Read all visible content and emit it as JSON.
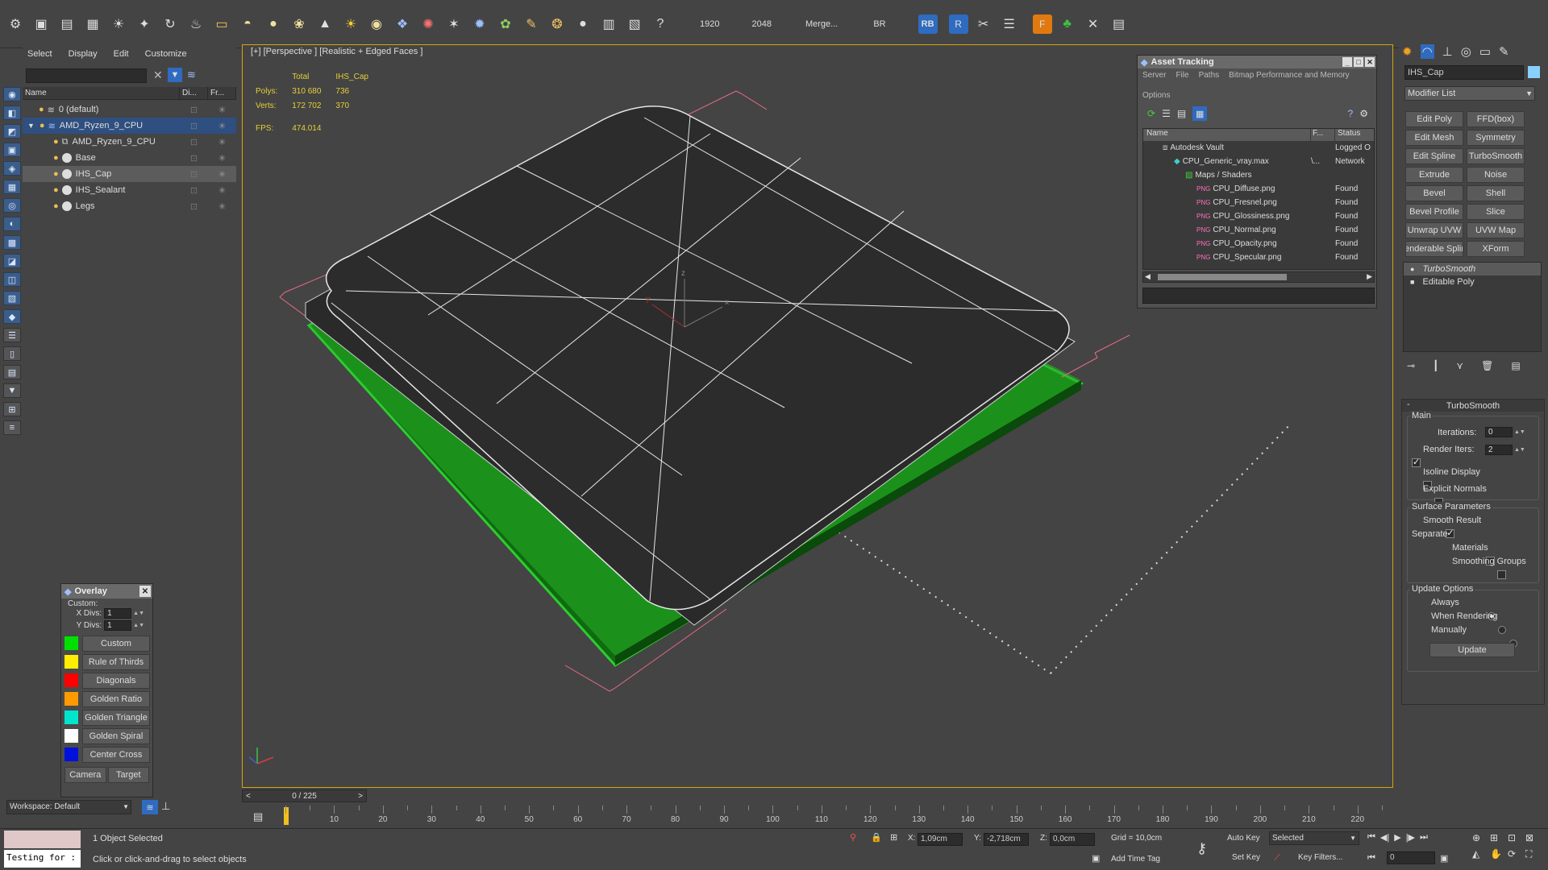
{
  "toolbar": {
    "render_width": "1920",
    "render_height": "2048",
    "merge_label": "Merge...",
    "br_label": "BR",
    "rb_label": "RB"
  },
  "scene_explorer": {
    "menu": [
      "Select",
      "Display",
      "Edit",
      "Customize"
    ],
    "columns": [
      "Name",
      "Di...",
      "Fr..."
    ],
    "rows": [
      {
        "name": "0 (default)"
      },
      {
        "name": "AMD_Ryzen_9_CPU"
      },
      {
        "name": "AMD_Ryzen_9_CPU"
      },
      {
        "name": "Base"
      },
      {
        "name": "IHS_Cap"
      },
      {
        "name": "IHS_Sealant"
      },
      {
        "name": "Legs"
      }
    ]
  },
  "overlay": {
    "title": "Overlay",
    "custom_label": "Custom:",
    "xdivs_label": "X Divs:",
    "xdivs_value": "1",
    "ydivs_label": "Y Divs:",
    "ydivs_value": "1",
    "items": [
      {
        "label": "Custom",
        "color": "#00e000"
      },
      {
        "label": "Rule of Thirds",
        "color": "#ffee00"
      },
      {
        "label": "Diagonals",
        "color": "#ff0000"
      },
      {
        "label": "Golden Ratio",
        "color": "#ff9900"
      },
      {
        "label": "Golden Triangle",
        "color": "#00e6cc"
      },
      {
        "label": "Golden Spiral",
        "color": "#ffffff"
      },
      {
        "label": "Center Cross",
        "color": "#0011dd"
      }
    ],
    "camera_label": "Camera",
    "target_label": "Target"
  },
  "viewport": {
    "label": "[+] [Perspective ] [Realistic + Edged Faces ]",
    "stats": {
      "total_header": "Total",
      "object_header": "IHS_Cap",
      "polys_label": "Polys:",
      "polys_total": "310 680",
      "polys_obj": "736",
      "verts_label": "Verts:",
      "verts_total": "172 702",
      "verts_obj": "370",
      "fps_label": "FPS:",
      "fps_value": "474.014"
    },
    "gizmo": {
      "x": "x",
      "y": "y",
      "z": "z"
    }
  },
  "asset_tracking": {
    "title": "Asset Tracking",
    "menu": [
      "Server",
      "File",
      "Paths",
      "Bitmap Performance and Memory",
      "Options"
    ],
    "columns": [
      "Name",
      "F...",
      "Status"
    ],
    "rows": [
      {
        "name": "Autodesk Vault",
        "f": "",
        "status": "Logged O"
      },
      {
        "name": "CPU_Generic_vray.max",
        "f": "\\...",
        "status": "Network"
      },
      {
        "name": "Maps / Shaders",
        "f": "",
        "status": ""
      },
      {
        "name": "CPU_Diffuse.png",
        "f": "",
        "status": "Found"
      },
      {
        "name": "CPU_Fresnel.png",
        "f": "",
        "status": "Found"
      },
      {
        "name": "CPU_Glossiness.png",
        "f": "",
        "status": "Found"
      },
      {
        "name": "CPU_Normal.png",
        "f": "",
        "status": "Found"
      },
      {
        "name": "CPU_Opacity.png",
        "f": "",
        "status": "Found"
      },
      {
        "name": "CPU_Specular.png",
        "f": "",
        "status": "Found"
      }
    ]
  },
  "command_panel": {
    "object_name": "IHS_Cap",
    "modifier_list": "Modifier List",
    "modifiers": [
      "Edit Poly",
      "FFD(box)",
      "Edit Mesh",
      "Symmetry",
      "Edit Spline",
      "TurboSmooth",
      "Extrude",
      "Noise",
      "Bevel",
      "Shell",
      "Bevel Profile",
      "Slice",
      "Unwrap UVW",
      "UVW Map",
      "enderable Splir",
      "XForm"
    ],
    "stack": [
      "TurboSmooth",
      "Editable Poly"
    ],
    "rollout_title": "TurboSmooth",
    "main_label": "Main",
    "iterations_label": "Iterations:",
    "iterations_value": "0",
    "render_iters_label": "Render Iters:",
    "render_iters_value": "2",
    "isoline_label": "Isoline Display",
    "explicit_normals_label": "Explicit Normals",
    "surface_params_label": "Surface Parameters",
    "smooth_result_label": "Smooth Result",
    "separate_label": "Separate",
    "materials_label": "Materials",
    "smoothing_groups_label": "Smoothing Groups",
    "update_options_label": "Update Options",
    "always_label": "Always",
    "when_rendering_label": "When Rendering",
    "manually_label": "Manually",
    "update_button": "Update"
  },
  "timeline": {
    "frame_counter": "0 / 225",
    "ticks": [
      "10",
      "20",
      "30",
      "40",
      "50",
      "60",
      "70",
      "80",
      "90",
      "100",
      "110",
      "120",
      "130",
      "140",
      "150",
      "160",
      "170",
      "180",
      "190",
      "200",
      "210",
      "220"
    ]
  },
  "status": {
    "workspace": "Workspace: Default",
    "script_text": "Testing for :",
    "selected_text": "1 Object Selected",
    "prompt_text": "Click or click-and-drag to select objects",
    "x_label": "X:",
    "x_value": "1,09cm",
    "y_label": "Y:",
    "y_value": "-2,718cm",
    "z_label": "Z:",
    "z_value": "0,0cm",
    "grid_text": "Grid = 10,0cm",
    "add_time_tag": "Add Time Tag",
    "auto_key": "Auto Key",
    "set_key": "Set Key",
    "selected_dropdown": "Selected",
    "key_filters": "Key Filters...",
    "frame_value": "0"
  }
}
